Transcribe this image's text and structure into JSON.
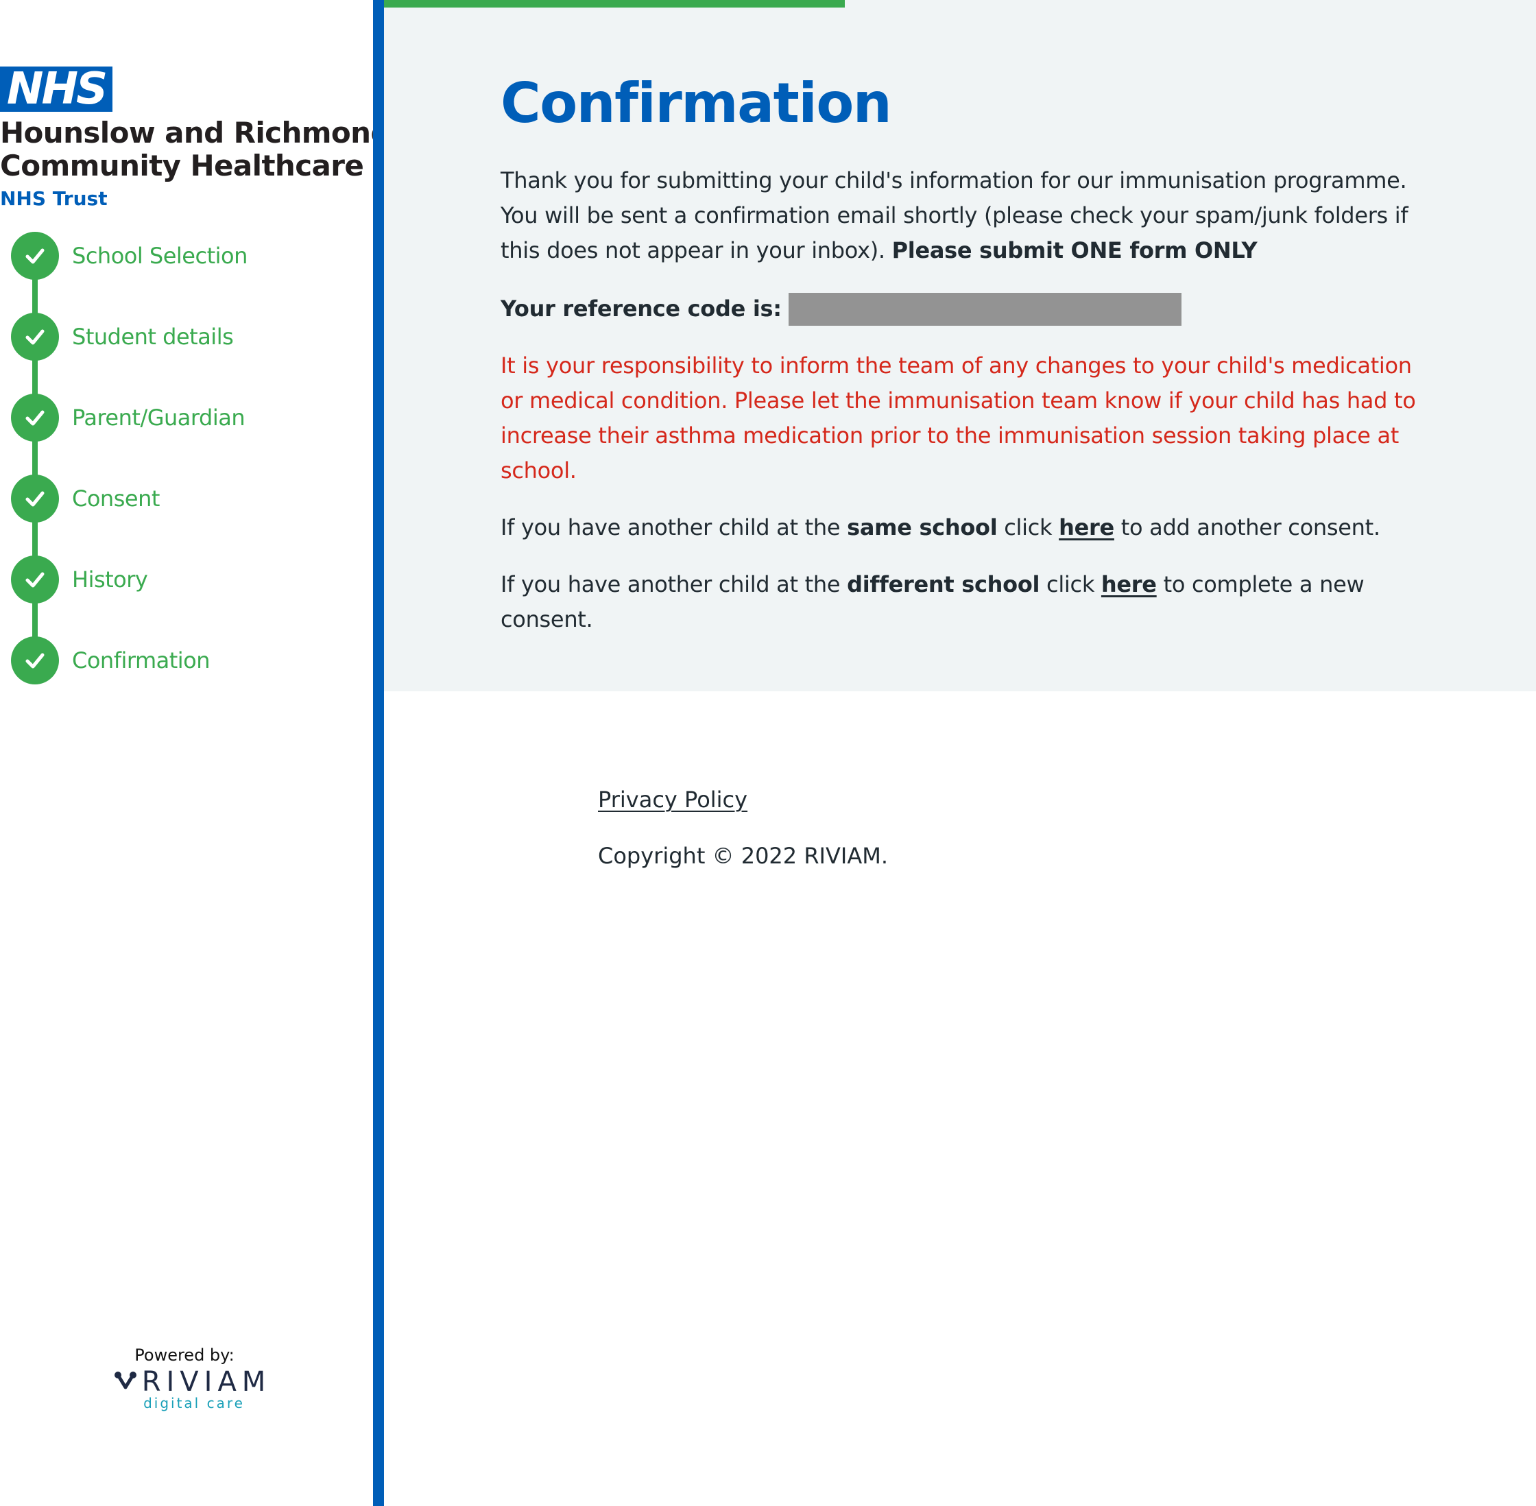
{
  "brand": {
    "logo_text": "NHS",
    "org_line1": "Hounslow and Richmond",
    "org_line2": "Community Healthcare",
    "org_trust": "NHS Trust",
    "nhs_blue": "#005eb8",
    "step_green": "#3aaa4f",
    "warning_red": "#d5281b"
  },
  "steps": [
    {
      "label": "School Selection",
      "status": "complete",
      "icon": "check-icon"
    },
    {
      "label": "Student details",
      "status": "complete",
      "icon": "check-icon"
    },
    {
      "label": "Parent/Guardian",
      "status": "complete",
      "icon": "check-icon"
    },
    {
      "label": "Consent",
      "status": "complete",
      "icon": "check-icon"
    },
    {
      "label": "History",
      "status": "complete",
      "icon": "check-icon"
    },
    {
      "label": "Confirmation",
      "status": "complete",
      "icon": "check-icon"
    }
  ],
  "powered_by": {
    "label": "Powered by:",
    "brand": "RIVIAM",
    "tagline": "digital care"
  },
  "main": {
    "progress_fraction": 0.4,
    "title": "Confirmation",
    "intro_text": "Thank you for submitting your child's information for our immunisation programme. You will be sent a confirmation email shortly (please check your spam/junk folders if this does not appear in your inbox). ",
    "intro_bold": "Please submit ONE form ONLY",
    "reference_label": "Your reference code is:",
    "reference_value_redacted": true,
    "warning": "It is your responsibility to inform the team of any changes to your child's medication or medical condition. Please let the immunisation team know if your child has had to increase their asthma medication prior to the immunisation session taking place at school.",
    "same_school": {
      "prefix": "If you have another child at the ",
      "bold": "same school",
      "middle": " click ",
      "link": "here",
      "suffix": " to add another consent."
    },
    "different_school": {
      "prefix": "If you have another child at the ",
      "bold": "different school",
      "middle": " click ",
      "link": "here",
      "suffix": " to complete a new consent."
    }
  },
  "footer": {
    "privacy_link": "Privacy Policy",
    "copyright": "Copyright © 2022 RIVIAM."
  }
}
